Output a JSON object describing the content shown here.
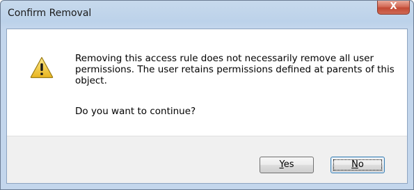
{
  "window": {
    "title": "Confirm Removal",
    "close_glyph": "X",
    "icon": "warning-icon"
  },
  "dialog": {
    "message": "Removing this access rule does not necessarily remove all user permissions. The user retains permissions defined at parents of this object.",
    "question": "Do you want to continue?"
  },
  "buttons": {
    "yes_mnemonic": "Y",
    "yes_rest": "es",
    "no_mnemonic": "N",
    "no_rest": "o"
  },
  "colors": {
    "titlebar": "#bcd2ea",
    "close_button": "#c24a35",
    "footer": "#f0f0f0",
    "warning_yellow": "#f5d547"
  }
}
